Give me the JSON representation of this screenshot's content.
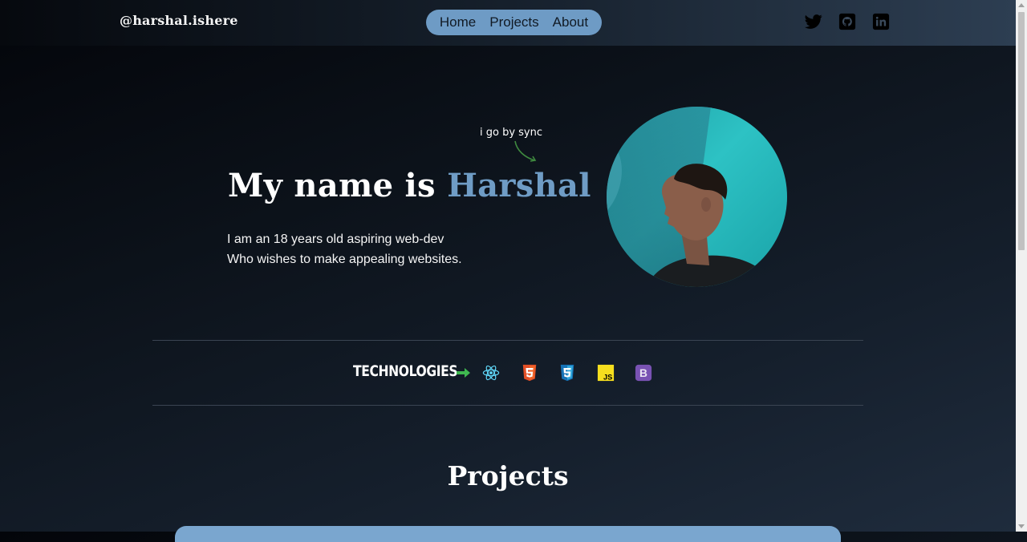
{
  "header": {
    "brand": "@harshal.ishere",
    "nav": [
      "Home",
      "Projects",
      "About"
    ],
    "social_icons": [
      "twitter-icon",
      "github-icon",
      "linkedin-icon"
    ]
  },
  "hero": {
    "nickname": "i go by sync",
    "title_prefix": "My name is ",
    "title_name": "Harshal",
    "subtitle_lines": [
      "I am an 18 years old aspiring web-dev",
      "Who wishes to make appealing websites."
    ],
    "avatar_alt": "profile photo"
  },
  "technologies": {
    "label": "TECHNOLOGIES",
    "icons": [
      "react-icon",
      "html5-icon",
      "css3-icon",
      "javascript-icon",
      "bootstrap-icon"
    ],
    "js_badge_text": "JS",
    "bootstrap_badge_text": "B"
  },
  "projects": {
    "title": "Projects"
  },
  "colors": {
    "accent": "#6f9cc5",
    "nav_bg": "#6e9bc5",
    "arrow_green": "#3fb950",
    "react": "#61dafb",
    "html5": "#e34f26",
    "css3": "#1572b6",
    "js": "#f7df1e",
    "bootstrap": "#7952b3"
  }
}
